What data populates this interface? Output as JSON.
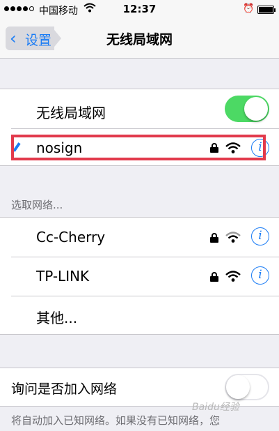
{
  "status_bar": {
    "carrier": "中国移动",
    "time": "12:37",
    "alarm_icon": "alarm-clock-icon",
    "battery_icon": "battery-full-icon"
  },
  "nav": {
    "back_label": "设置",
    "title": "无线局域网"
  },
  "wifi_toggle": {
    "label": "无线局域网",
    "state": "on"
  },
  "connected_network": {
    "name": "nosign",
    "secured": true
  },
  "choose_network": {
    "header": "选取网络...",
    "networks": [
      {
        "name": "Cc-Cherry",
        "secured": true
      },
      {
        "name": "TP-LINK",
        "secured": true
      }
    ],
    "other_label": "其他..."
  },
  "ask_to_join": {
    "label": "询问是否加入网络",
    "state": "off",
    "description": "将自动加入已知网络。如果没有已知网络，您"
  },
  "watermark": "Baidu经验",
  "colors": {
    "accent": "#1a7cf5",
    "toggle_on": "#4cd964",
    "highlight": "#e23a4c"
  }
}
